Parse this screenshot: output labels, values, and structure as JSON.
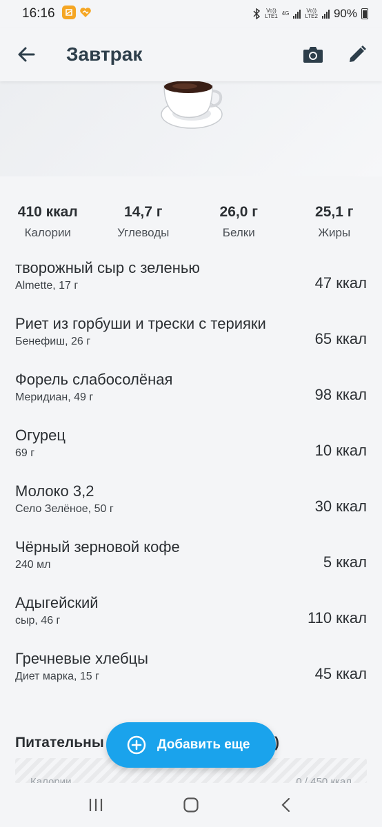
{
  "status_bar": {
    "time": "16:16",
    "battery": "90%",
    "net1": "Vo))\nLTE1",
    "net2": "4G",
    "net3": "Vo))\nLTE2"
  },
  "app_bar": {
    "title": "Завтрак",
    "icons": [
      "back-arrow-icon",
      "camera-icon",
      "pencil-icon"
    ]
  },
  "macros": [
    {
      "value": "410 ккал",
      "label": "Калории"
    },
    {
      "value": "14,7 г",
      "label": "Углеводы"
    },
    {
      "value": "26,0 г",
      "label": "Белки"
    },
    {
      "value": "25,1 г",
      "label": "Жиры"
    }
  ],
  "foods": [
    {
      "name": "творожный сыр с зеленью",
      "sub": "Almette, 17 г",
      "kcal": "47 ккал"
    },
    {
      "name": "Риет из горбуши и трески с терияки",
      "sub": "Бенефиш, 26 г",
      "kcal": "65 ккал"
    },
    {
      "name": "Форель слабосолёная",
      "sub": "Меридиан, 49 г",
      "kcal": "98 ккал"
    },
    {
      "name": "Огурец",
      "sub": "69 г",
      "kcal": "10 ккал"
    },
    {
      "name": "Молоко 3,2",
      "sub": "Село Зелёное, 50 г",
      "kcal": "30 ккал"
    },
    {
      "name": "Чёрный зерновой кофе",
      "sub": "240 мл",
      "kcal": "5 ккал"
    },
    {
      "name": "Адыгейский",
      "sub": "сыр, 46 г",
      "kcal": "110 ккал"
    },
    {
      "name": "Гречневые хлебцы",
      "sub": "Диет марка, 15 г",
      "kcal": "45 ккал"
    }
  ],
  "nutrients": {
    "title_start": "Питательны",
    "title_end": ")",
    "row_label": "Калории",
    "row_value": "0 / 450 ккал"
  },
  "fab": {
    "label": "Добавить еще"
  },
  "colors": {
    "accent": "#1aa3ec",
    "title": "#2d3e4a",
    "background": "#f4f5f7"
  }
}
